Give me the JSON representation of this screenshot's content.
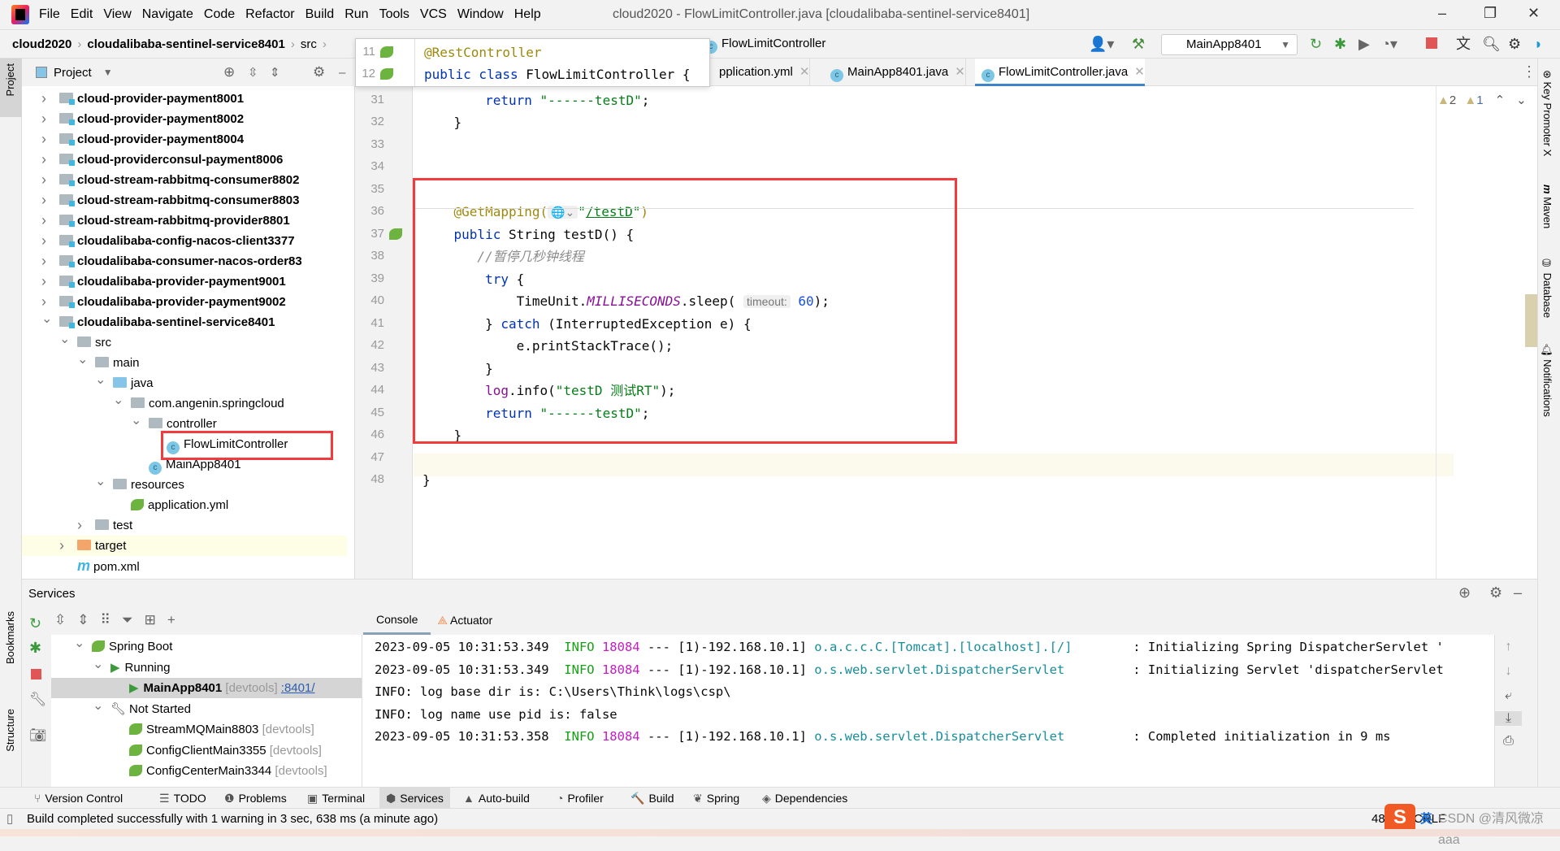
{
  "menu": {
    "items": [
      "File",
      "Edit",
      "View",
      "Navigate",
      "Code",
      "Refactor",
      "Build",
      "Run",
      "Tools",
      "VCS",
      "Window",
      "Help"
    ],
    "title": "cloud2020 - FlowLimitController.java [cloudalibaba-sentinel-service8401]"
  },
  "nav": {
    "crumbs": [
      "cloud2020",
      "cloudalibaba-sentinel-service8401",
      "src"
    ],
    "file_crumb": "FlowLimitController",
    "run_config": "MainApp8401"
  },
  "project": {
    "title": "Project",
    "tree": [
      {
        "label": "cloud-provider-payment8001",
        "depth": 0,
        "type": "module",
        "expand": "collapsed"
      },
      {
        "label": "cloud-provider-payment8002",
        "depth": 0,
        "type": "module",
        "expand": "collapsed"
      },
      {
        "label": "cloud-provider-payment8004",
        "depth": 0,
        "type": "module",
        "expand": "collapsed"
      },
      {
        "label": "cloud-providerconsul-payment8006",
        "depth": 0,
        "type": "module",
        "expand": "collapsed"
      },
      {
        "label": "cloud-stream-rabbitmq-consumer8802",
        "depth": 0,
        "type": "module",
        "expand": "collapsed"
      },
      {
        "label": "cloud-stream-rabbitmq-consumer8803",
        "depth": 0,
        "type": "module",
        "expand": "collapsed"
      },
      {
        "label": "cloud-stream-rabbitmq-provider8801",
        "depth": 0,
        "type": "module",
        "expand": "collapsed"
      },
      {
        "label": "cloudalibaba-config-nacos-client3377",
        "depth": 0,
        "type": "module",
        "expand": "collapsed"
      },
      {
        "label": "cloudalibaba-consumer-nacos-order83",
        "depth": 0,
        "type": "module",
        "expand": "collapsed"
      },
      {
        "label": "cloudalibaba-provider-payment9001",
        "depth": 0,
        "type": "module",
        "expand": "collapsed"
      },
      {
        "label": "cloudalibaba-provider-payment9002",
        "depth": 0,
        "type": "module",
        "expand": "collapsed"
      },
      {
        "label": "cloudalibaba-sentinel-service8401",
        "depth": 0,
        "type": "module",
        "expand": "expanded"
      },
      {
        "label": "src",
        "depth": 1,
        "type": "folder",
        "expand": "expanded"
      },
      {
        "label": "main",
        "depth": 2,
        "type": "folder",
        "expand": "expanded"
      },
      {
        "label": "java",
        "depth": 3,
        "type": "src",
        "expand": "expanded"
      },
      {
        "label": "com.angenin.springcloud",
        "depth": 4,
        "type": "folder",
        "expand": "expanded"
      },
      {
        "label": "controller",
        "depth": 5,
        "type": "folder",
        "expand": "expanded"
      },
      {
        "label": "FlowLimitController",
        "depth": 6,
        "type": "class",
        "expand": "none"
      },
      {
        "label": "MainApp8401",
        "depth": 5,
        "type": "class",
        "expand": "none"
      },
      {
        "label": "resources",
        "depth": 3,
        "type": "folder",
        "expand": "expanded"
      },
      {
        "label": "application.yml",
        "depth": 4,
        "type": "spring",
        "expand": "none"
      },
      {
        "label": "test",
        "depth": 2,
        "type": "folder",
        "expand": "collapsed"
      },
      {
        "label": "target",
        "depth": 1,
        "type": "target",
        "expand": "collapsed"
      },
      {
        "label": "pom.xml",
        "depth": 1,
        "type": "maven",
        "expand": "none"
      }
    ]
  },
  "editor": {
    "tabs": [
      {
        "label": "pplication.yml",
        "active": false
      },
      {
        "label": "MainApp8401.java",
        "active": false
      },
      {
        "label": "FlowLimitController.java",
        "active": true
      }
    ],
    "inspections": {
      "warnings": "2",
      "weak_warnings": "1"
    },
    "sticky": [
      {
        "line": "11",
        "tokens": [
          [
            "ann",
            "@RestController"
          ]
        ]
      },
      {
        "line": "12",
        "tokens": [
          [
            "kw",
            "public class "
          ],
          [
            "pl",
            "FlowLimitController "
          ],
          [
            "pl",
            "{"
          ]
        ]
      }
    ],
    "lines": [
      {
        "n": "31",
        "tokens": [
          [
            "kw",
            "        return "
          ],
          [
            "str",
            "\"------testD\""
          ],
          [
            "pl",
            ";"
          ]
        ]
      },
      {
        "n": "32",
        "tokens": [
          [
            "pl",
            "    }"
          ]
        ]
      },
      {
        "n": "33",
        "tokens": []
      },
      {
        "n": "34",
        "tokens": []
      },
      {
        "n": "35",
        "tokens": []
      },
      {
        "n": "36",
        "tokens": [
          [
            "ann",
            "    @GetMapping("
          ],
          [
            "hint",
            "🌐⌄"
          ],
          [
            "str",
            "\""
          ],
          [
            "strlink",
            "/testD"
          ],
          [
            "str",
            "\""
          ],
          [
            "ann",
            ")"
          ]
        ]
      },
      {
        "n": "37",
        "tokens": [
          [
            "kw",
            "    public "
          ],
          [
            "pl",
            "String testD() {"
          ]
        ]
      },
      {
        "n": "38",
        "tokens": [
          [
            "cmt",
            "       //暂停几秒钟线程"
          ]
        ]
      },
      {
        "n": "39",
        "tokens": [
          [
            "kw",
            "        try "
          ],
          [
            "pl",
            "{"
          ]
        ]
      },
      {
        "n": "40",
        "tokens": [
          [
            "pl",
            "            TimeUnit."
          ],
          [
            "fld",
            "MILLISECONDS"
          ],
          [
            "pl",
            ".sleep( "
          ],
          [
            "hint",
            "timeout:"
          ],
          [
            "num",
            " 60"
          ],
          [
            "pl",
            ");"
          ]
        ]
      },
      {
        "n": "41",
        "tokens": [
          [
            "pl",
            "        } "
          ],
          [
            "kw",
            "catch "
          ],
          [
            "pl",
            "(InterruptedException e) {"
          ]
        ]
      },
      {
        "n": "42",
        "tokens": [
          [
            "pl",
            "            e.printStackTrace();"
          ]
        ]
      },
      {
        "n": "43",
        "tokens": [
          [
            "pl",
            "        }"
          ]
        ]
      },
      {
        "n": "44",
        "tokens": [
          [
            "logf",
            "        log"
          ],
          [
            "pl",
            ".info("
          ],
          [
            "str",
            "\"testD 测试RT\""
          ],
          [
            "pl",
            ");"
          ]
        ]
      },
      {
        "n": "45",
        "tokens": [
          [
            "kw",
            "        return "
          ],
          [
            "str",
            "\"------testD\""
          ],
          [
            "pl",
            ";"
          ]
        ]
      },
      {
        "n": "46",
        "tokens": [
          [
            "pl",
            "    }"
          ]
        ]
      },
      {
        "n": "47",
        "tokens": []
      },
      {
        "n": "48",
        "tokens": [
          [
            "pl",
            "}"
          ]
        ]
      }
    ]
  },
  "right_stripe": [
    "Key Promoter X",
    "Maven",
    "Database",
    "Notifications"
  ],
  "left_stripe": [
    "Project",
    "Bookmarks",
    "Structure"
  ],
  "services": {
    "title": "Services",
    "tree": [
      {
        "label": "Spring Boot",
        "depth": 0,
        "expand": "expanded",
        "icon": "spring",
        "suffix": "",
        "link": ""
      },
      {
        "label": "Running",
        "depth": 1,
        "expand": "expanded",
        "icon": "run",
        "suffix": "",
        "link": ""
      },
      {
        "label": "MainApp8401",
        "depth": 2,
        "expand": "none",
        "icon": "run",
        "suffix": " [devtools] ",
        "link": ":8401/",
        "selected": true
      },
      {
        "label": "Not Started",
        "depth": 1,
        "expand": "expanded",
        "icon": "wrench",
        "suffix": "",
        "link": ""
      },
      {
        "label": "StreamMQMain8803",
        "depth": 2,
        "expand": "none",
        "icon": "spring",
        "suffix": " [devtools]",
        "link": ""
      },
      {
        "label": "ConfigClientMain3355",
        "depth": 2,
        "expand": "none",
        "icon": "spring",
        "suffix": " [devtools]",
        "link": ""
      },
      {
        "label": "ConfigCenterMain3344",
        "depth": 2,
        "expand": "none",
        "icon": "spring",
        "suffix": " [devtools]",
        "link": ""
      }
    ],
    "tabs": [
      "Console",
      "Actuator"
    ],
    "console": [
      [
        [
          "pl",
          "2023-09-05 10:31:53.349  "
        ],
        [
          "info",
          "INFO "
        ],
        [
          "pid",
          "18084"
        ],
        [
          "pl",
          " --- [1)-192.168.10.1] "
        ],
        [
          "logger",
          "o.a.c.c.C.[Tomcat].[localhost].[/]      "
        ],
        [
          "pl",
          "  : Initializing Spring DispatcherServlet '"
        ]
      ],
      [
        [
          "pl",
          "2023-09-05 10:31:53.349  "
        ],
        [
          "info",
          "INFO "
        ],
        [
          "pid",
          "18084"
        ],
        [
          "pl",
          " --- [1)-192.168.10.1] "
        ],
        [
          "logger",
          "o.s.web.servlet.DispatcherServlet       "
        ],
        [
          "pl",
          "  : Initializing Servlet 'dispatcherServlet"
        ]
      ],
      [
        [
          "pl",
          "INFO: log base dir is: C:\\Users\\Think\\logs\\csp\\"
        ]
      ],
      [
        [
          "pl",
          "INFO: log name use pid is: false"
        ]
      ],
      [
        [
          "pl",
          "2023-09-05 10:31:53.358  "
        ],
        [
          "info",
          "INFO "
        ],
        [
          "pid",
          "18084"
        ],
        [
          "pl",
          " --- [1)-192.168.10.1] "
        ],
        [
          "logger",
          "o.s.web.servlet.DispatcherServlet       "
        ],
        [
          "pl",
          "  : Completed initialization in 9 ms"
        ]
      ]
    ]
  },
  "bottom_tools": [
    {
      "label": "Version Control",
      "icon": "⑂"
    },
    {
      "label": "TODO",
      "icon": "☰"
    },
    {
      "label": "Problems",
      "icon": "❶"
    },
    {
      "label": "Terminal",
      "icon": "▣"
    },
    {
      "label": "Services",
      "icon": "⬢",
      "active": true
    },
    {
      "label": "Auto-build",
      "icon": "▲"
    },
    {
      "label": "Profiler",
      "icon": "◔"
    },
    {
      "label": "Build",
      "icon": "🔨"
    },
    {
      "label": "Spring",
      "icon": "❦"
    },
    {
      "label": "Dependencies",
      "icon": "◈"
    }
  ],
  "status": {
    "message": "Build completed successfully with 1 warning in 3 sec, 638 ms (a minute ago)",
    "position": "48:2",
    "line_sep": "CRLF",
    "watermark": "CSDN @清风微凉 aaa",
    "ime": "英"
  }
}
